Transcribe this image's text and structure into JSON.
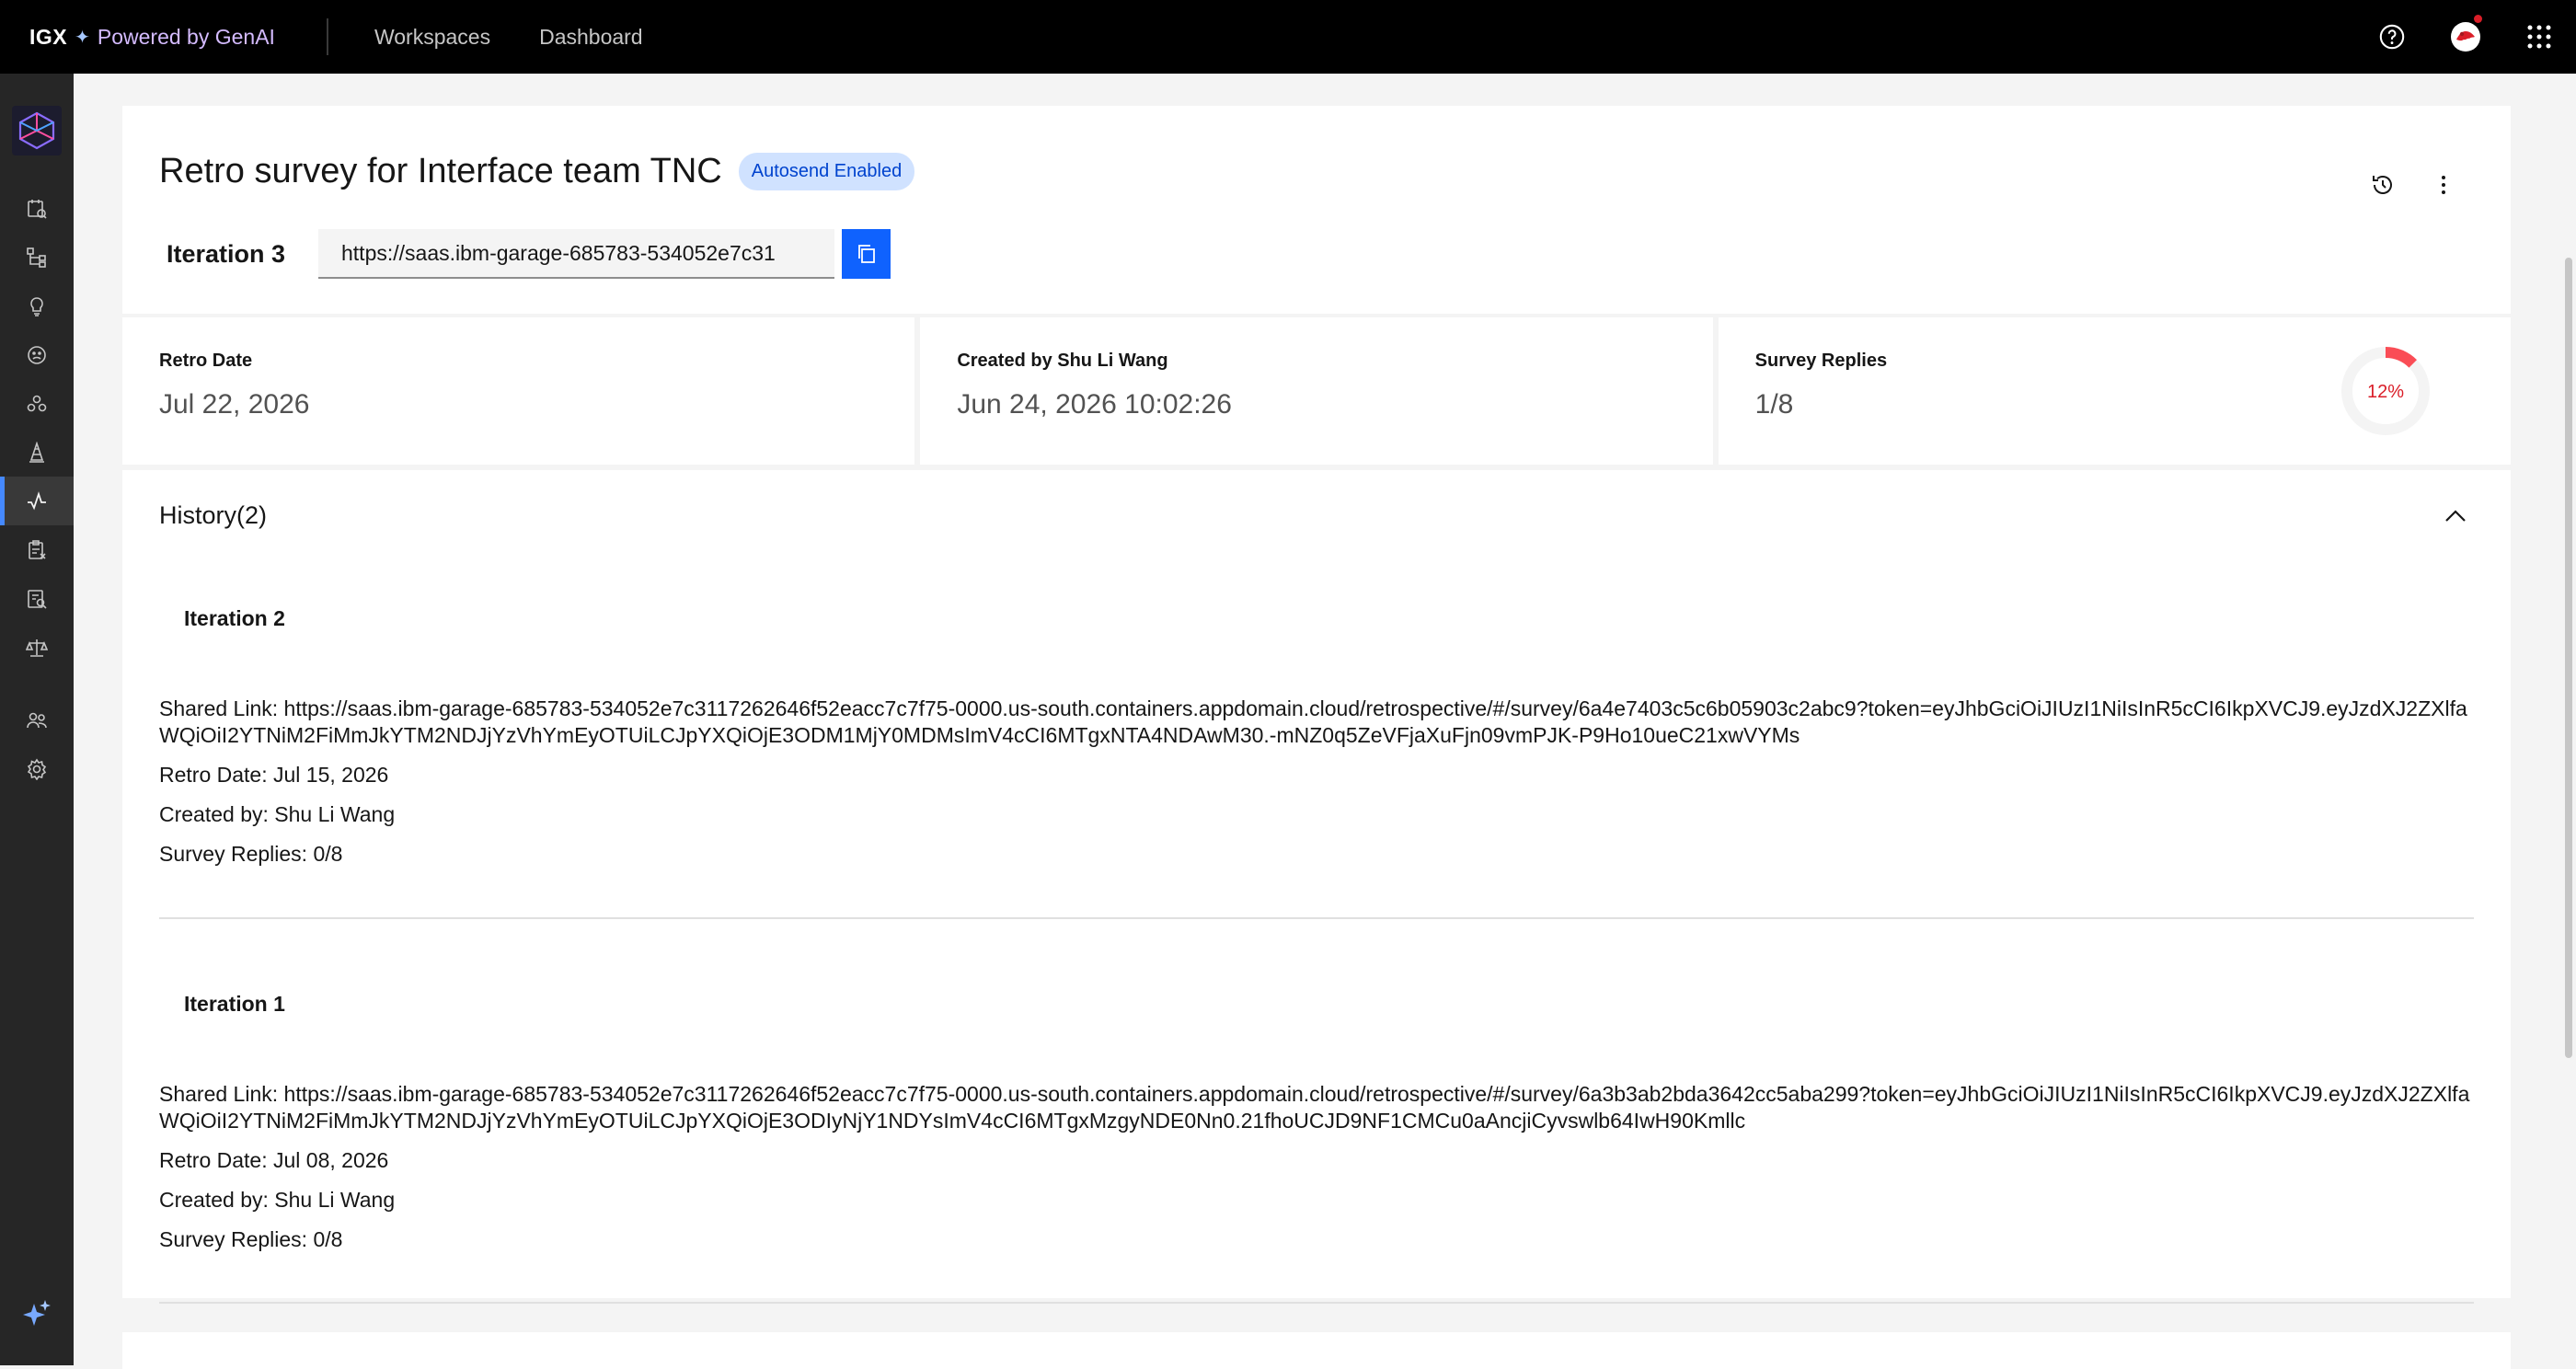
{
  "header": {
    "brand": "IGX",
    "brand_star": "✦",
    "powered": "Powered by GenAI",
    "nav": [
      "Workspaces",
      "Dashboard"
    ]
  },
  "page": {
    "title": "Retro survey for Interface team TNC",
    "tag": "Autosend Enabled",
    "iteration_label": "Iteration 3",
    "link_value": "https://saas.ibm-garage-685783-534052e7c31"
  },
  "stats": [
    {
      "label": "Retro Date",
      "value": "Jul 22, 2026"
    },
    {
      "label": "Created by Shu Li Wang",
      "value": "Jun 24, 2026 10:02:26"
    },
    {
      "label": "Survey Replies",
      "value": "1/8",
      "percent_label": "12%",
      "percent": 0.125
    }
  ],
  "history": {
    "title": "History(2)",
    "items": [
      {
        "title": "Iteration 2",
        "shared_link": "Shared Link: https://saas.ibm-garage-685783-534052e7c3117262646f52eacc7c7f75-0000.us-south.containers.appdomain.cloud/retrospective/#/survey/6a4e7403c5c6b05903c2abc9?token=eyJhbGciOiJIUzI1NiIsInR5cCI6IkpXVCJ9.eyJzdXJ2ZXlfaWQiOiI2YTNiM2FiMmJkYTM2NDJjYzVhYmEyOTUiLCJpYXQiOjE3ODM1MjY0MDMsImV4cCI6MTgxNTA4NDAwM30.-mNZ0q5ZeVFjaXuFjn09vmPJK-P9Ho10ueC21xwVYMs",
        "retro_date": "Retro Date: Jul 15, 2026",
        "created_by": "Created by: Shu Li Wang",
        "replies": "Survey Replies: 0/8"
      },
      {
        "title": "Iteration 1",
        "shared_link": "Shared Link: https://saas.ibm-garage-685783-534052e7c3117262646f52eacc7c7f75-0000.us-south.containers.appdomain.cloud/retrospective/#/survey/6a3b3ab2bda3642cc5aba299?token=eyJhbGciOiJIUzI1NiIsInR5cCI6IkpXVCJ9.eyJzdXJ2ZXlfaWQiOiI2YTNiM2FiMmJkYTM2NDJjYzVhYmEyOTUiLCJpYXQiOjE3ODIyNjY1NDYsImV4cCI6MTgxMzgyNDE0Nn0.21fhoUCJD9NF1CMCu0aAncjiCyvswlb64IwH90Kmllc",
        "retro_date": "Retro Date: Jul 08, 2026",
        "created_by": "Created by: Shu Li Wang",
        "replies": "Survey Replies: 0/8"
      }
    ]
  },
  "colors": {
    "accent": "#0f62fe",
    "tag_bg": "#d0e2ff",
    "donut_fill": "#fa4d56",
    "donut_track": "#f4f4f4"
  },
  "icons": [
    "help-icon",
    "avatar-icon",
    "app-switcher-icon",
    "history-icon",
    "overflow-menu-icon",
    "copy-icon",
    "chevron-up-icon",
    "ai-sparkle-icon"
  ]
}
